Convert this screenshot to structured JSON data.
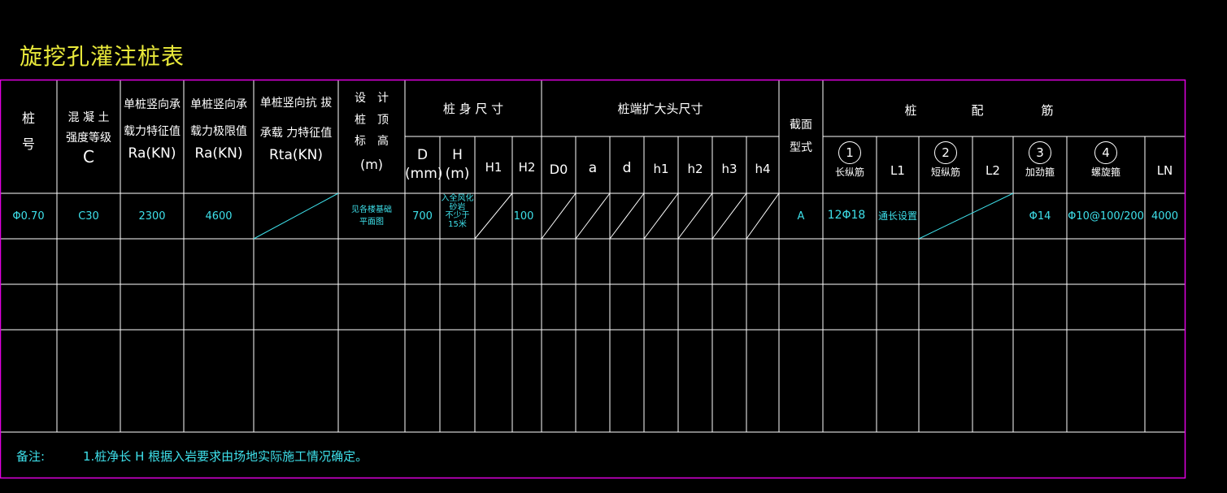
{
  "title": "旋挖孔灌注桩表",
  "header": {
    "pile_no": [
      "桩",
      "号"
    ],
    "concrete": [
      "混 凝 土",
      "强度等级"
    ],
    "concrete_sym": "C",
    "ra": [
      "单桩竖向承",
      "载力特征值"
    ],
    "ra_sym": "Ra(KN)",
    "ra_limit": [
      "单桩竖向承",
      "载力极限值"
    ],
    "ra_limit_sym": "Ra(KN)",
    "rta": [
      "单桩竖向抗 拔",
      "承载 力特征值"
    ],
    "rta_sym": "Rta(KN)",
    "elev": [
      "设　计",
      "桩　顶",
      "标　高"
    ],
    "elev_sym": "(m)",
    "body_group": "桩 身 尺 寸",
    "D": "D",
    "D_unit": "(mm)",
    "H": "H",
    "H_unit": "(m)",
    "H1": "H1",
    "H2": "H2",
    "enlarge_group": "桩端扩大头尺寸",
    "D0": "D0",
    "a": "a",
    "d": "d",
    "h1": "h1",
    "h2": "h2",
    "h3": "h3",
    "h4": "h4",
    "section": [
      "截面",
      "型式"
    ],
    "rebar_group": [
      "桩",
      "配",
      "筋"
    ],
    "r1": "1",
    "r1_label": "长纵筋",
    "L1": "L1",
    "r2": "2",
    "r2_label": "短纵筋",
    "L2": "L2",
    "r3": "3",
    "r3_label": "加劲箍",
    "r4": "4",
    "r4_label": "螺旋箍",
    "LN": "LN"
  },
  "rows": [
    {
      "pile_no": "Φ0.70",
      "concrete": "C30",
      "ra": "2300",
      "ra_limit": "4600",
      "elev": [
        "见各楼基础",
        "平面图"
      ],
      "D": "700",
      "H": [
        "入全风化",
        "砂岩",
        "不少于",
        "15米"
      ],
      "H2": "100",
      "section": "A",
      "r1": "12Φ18",
      "L1": "通长设置",
      "r3": "Φ14",
      "r4": "Φ10@100/200",
      "LN": "4000"
    }
  ],
  "note_label": "备注:",
  "note_text": "1.桩净长 H 根据入岩要求由场地实际施工情况确定。",
  "colors": {
    "grid": "#ffffff",
    "border": "#e000e0",
    "cyan": "#3ee0ea",
    "yellow": "#e8e83a"
  }
}
